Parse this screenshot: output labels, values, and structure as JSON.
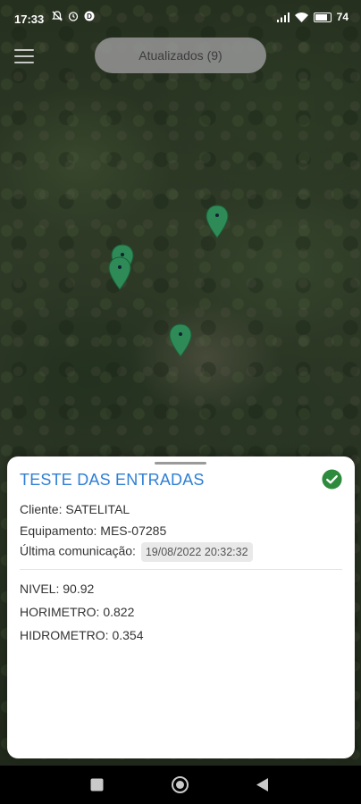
{
  "status_bar": {
    "time": "17:33",
    "battery_percent": "74",
    "left_icons": [
      "mute-icon",
      "alarm-icon",
      "app-notification-icon"
    ],
    "right_icons": [
      "signal-icon",
      "wifi-icon",
      "battery-icon"
    ]
  },
  "map": {
    "updated_label": "Atualizados (9)",
    "marker_color": "#2e8b57"
  },
  "sheet": {
    "title": "TESTE DAS ENTRADAS",
    "status_color": "#2e8b3e",
    "cliente_label": "Cliente:",
    "cliente_value": "SATELITAL",
    "equipamento_label": "Equipamento:",
    "equipamento_value": "MES-07285",
    "ultima_label": "Última comunicação:",
    "ultima_value": "19/08/2022 20:32:32",
    "readings": [
      {
        "label": "NIVEL:",
        "value": "90.92"
      },
      {
        "label": "HORIMETRO:",
        "value": "0.822"
      },
      {
        "label": "HIDROMETRO:",
        "value": "0.354"
      }
    ]
  },
  "nav": {
    "icons": [
      "recents-square-icon",
      "home-circle-icon",
      "back-triangle-icon"
    ]
  }
}
